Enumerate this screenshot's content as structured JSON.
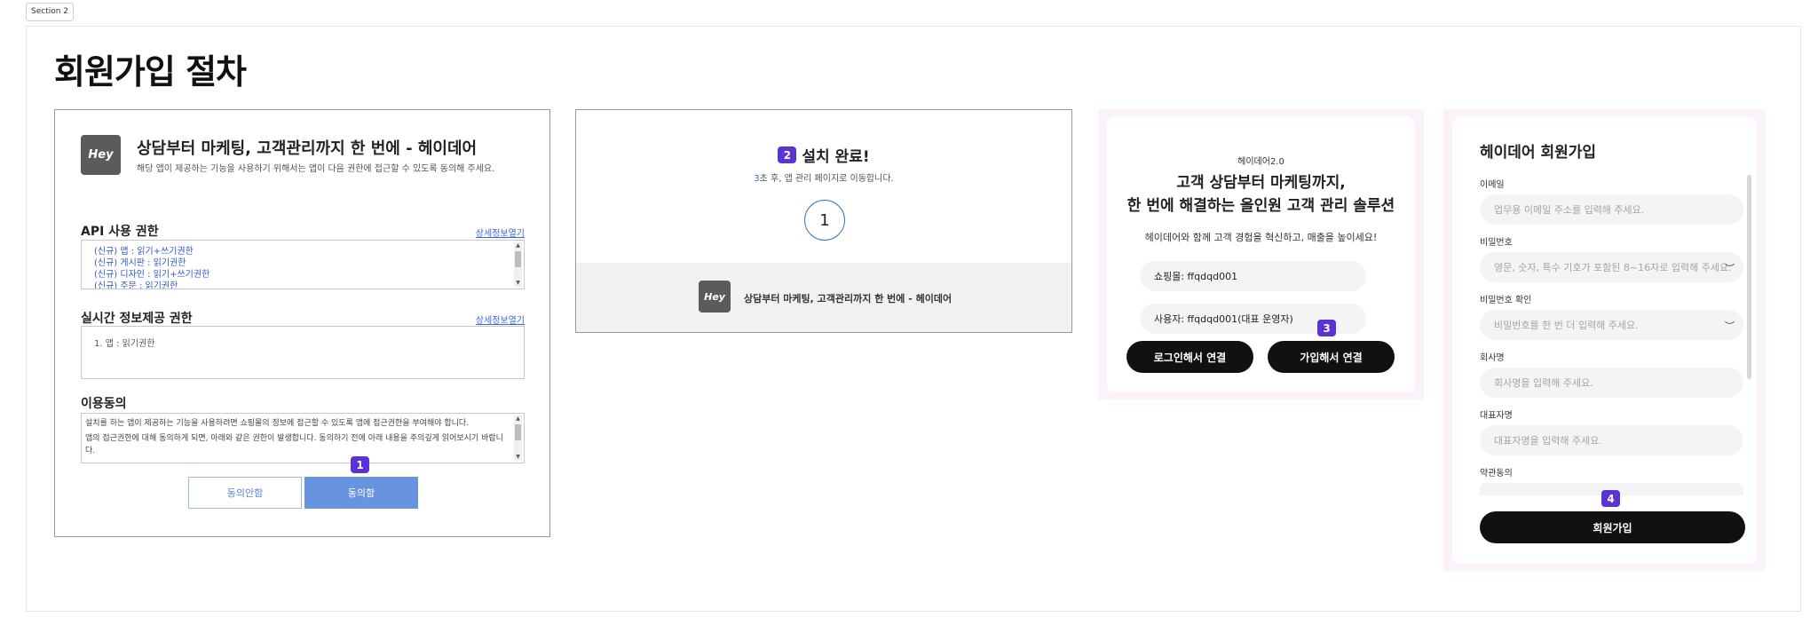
{
  "section_tag": "Section 2",
  "page_title": "회원가입 절차",
  "panel1": {
    "logo_text": "Hey",
    "title": "상담부터 마케팅, 고객관리까지 한 번에 - 헤이데어",
    "subtitle": "해당 앱이 제공하는 기능을 사용하기 위해서는 앱이 다음 권한에 접근할 수 있도록 동의해 주세요.",
    "api_label": "API 사용 권한",
    "api_detail_link": "상세정보열기",
    "api_permissions": [
      "(신규) 앱 : 읽기+쓰기권한",
      "(신규) 게시판 : 읽기권한",
      "(신규) 디자인 : 읽기+쓰기권한",
      "(신규) 주문 : 읽기권한"
    ],
    "realtime_label": "실시간 정보제공 권한",
    "realtime_detail_link": "상세정보열기",
    "realtime_item": "1. 앱 : 읽기권한",
    "consent_label": "이용동의",
    "consent_text_1": "설치를 하는 앱이 제공하는 기능을 사용하려면 쇼핑몰의 정보에 접근할 수 있도록 앱에 접근권한을 부여해야 합니다.",
    "consent_text_2": "앱의 접근권한에 대해 동의하게 되면, 아래와 같은 권한이 발생합니다. 동의하기 전에 아래 내용을 주의깊게 읽어보시기 바랍니다.",
    "disagree_button": "동의안함",
    "agree_button": "동의함",
    "step_badge": "1"
  },
  "panel2": {
    "step_badge": "2",
    "title": "설치 완료!",
    "countdown_seconds": "3",
    "redirect_text": "초 후, 앱 관리 페이지로 이동합니다.",
    "countdown_display": "1",
    "logo_text": "Hey",
    "footer_text": "상담부터 마케팅, 고객관리까지 한 번에 - 헤이데어"
  },
  "panel3": {
    "brand": "헤이데어2.0",
    "headline_1": "고객 상담부터 마케팅까지,",
    "headline_2": "한 번에 해결하는 올인원 고객 관리 솔루션",
    "description": "헤이데어와 함께 고객 경험을 혁신하고, 매출을 높이세요!",
    "shop_field": "쇼핑몰: ffqdqd001",
    "user_field": "사용자: ffqdqd001(대표 운영자)",
    "login_connect_button": "로그인해서 연결",
    "signup_connect_button": "가입해서 연결",
    "step_badge": "3"
  },
  "panel4": {
    "title": "헤이데어 회원가입",
    "email_label": "이메일",
    "email_placeholder": "업무용 이메일 주소를 입력해 주세요.",
    "password_label": "비밀번호",
    "password_placeholder": "영문, 숫자, 특수 기호가 포함된 8~16자로 입력해 주세요.",
    "password_confirm_label": "비밀번호 확인",
    "password_confirm_placeholder": "비밀번호를 한 번 더 입력해 주세요.",
    "company_label": "회사명",
    "company_placeholder": "회사명을 입력해 주세요.",
    "ceo_label": "대표자명",
    "ceo_placeholder": "대표자명을 입력해 주세요.",
    "terms_label": "약관동의",
    "submit_button": "회원가입",
    "step_badge": "4"
  },
  "colors": {
    "step_badge": "#5b32d6",
    "agree_button": "#6893df",
    "link": "#3a67d8",
    "primary_dark": "#111111",
    "panel_bg_pink": "#fbf2fb"
  }
}
